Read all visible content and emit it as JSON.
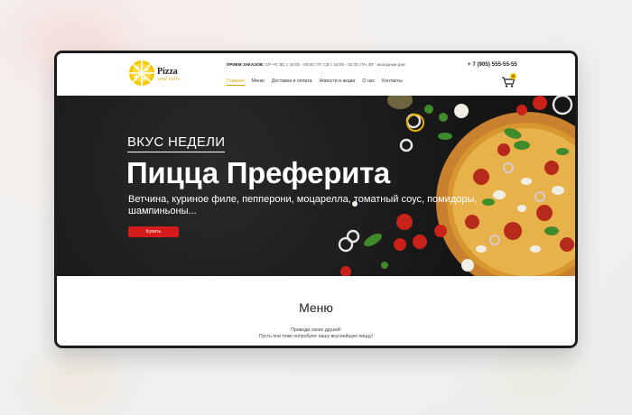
{
  "logo": {
    "line1": "Pizza",
    "line2": "and rolls"
  },
  "header": {
    "hours_label": "ПРИЕМ ЗАКАЗОВ:",
    "hours_text": " СР-ЧТ, ВС с 15:00 - 00:00; ПТ, СБ с 15:00 - 02:00; ПН, ВТ - выходные дни",
    "phone": "+ 7 (905) 555-55-55",
    "cart_count": "0"
  },
  "nav": {
    "items": [
      {
        "label": "Главная",
        "active": true
      },
      {
        "label": "Меню"
      },
      {
        "label": "Доставка и оплата"
      },
      {
        "label": "Новости и акции"
      },
      {
        "label": "О нас"
      },
      {
        "label": "Контакты"
      }
    ]
  },
  "hero": {
    "kicker": "ВКУС НЕДЕЛИ",
    "title": "Пицца Преферита",
    "description": "Ветчина, куриное филе, пепперони, моцарелла, томатный соус, помидоры, шампиньоны...",
    "button": "Купить"
  },
  "menu_section": {
    "title": "Меню",
    "line1": "Приводи своих друзей!",
    "line2": "Пусть они тоже попробуют нашу вкуснейшую пиццу!"
  },
  "colors": {
    "accent": "#e2a600",
    "button": "#d51b1b",
    "hero_bg": "#1a1a1a"
  }
}
